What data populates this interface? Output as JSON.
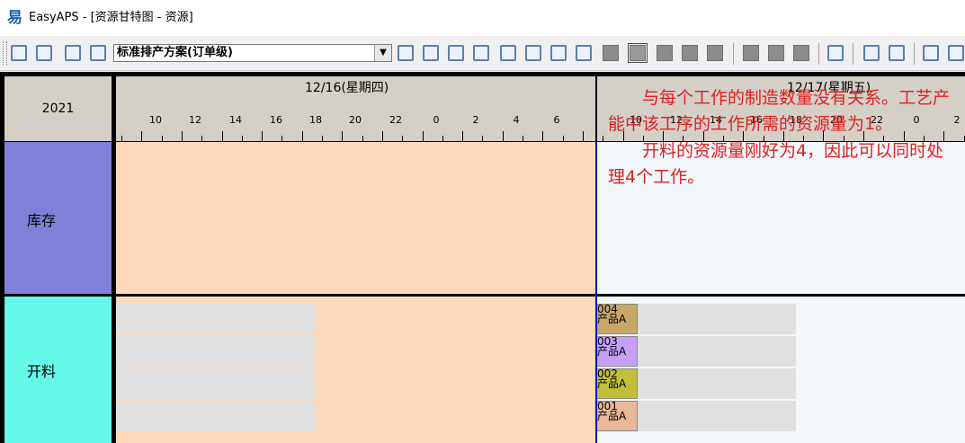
{
  "window": {
    "app_icon": "易",
    "title": "EasyAPS - [资源甘特图 - 资源]"
  },
  "toolbar": {
    "scheme_value": "标准排产方案(订单级)",
    "scheme_arrow": "▼"
  },
  "gantt": {
    "year": "2021",
    "days": [
      "12/16(星期四)",
      "12/17(星期五)"
    ],
    "hour_labels": [
      "10",
      "12",
      "14",
      "16",
      "18",
      "20",
      "22",
      "0",
      "2",
      "4",
      "6",
      "10",
      "12",
      "14",
      "16",
      "18",
      "20",
      "22",
      "0",
      "2"
    ],
    "resources": [
      {
        "name": "库存",
        "color": "#8080d8"
      },
      {
        "name": "开料",
        "color": "#66f8e8"
      }
    ],
    "tasks": [
      {
        "code": "004",
        "product": "产品A",
        "color": "#c8a868"
      },
      {
        "code": "003",
        "product": "产品A",
        "color": "#c4a0f8"
      },
      {
        "code": "002",
        "product": "产品A",
        "color": "#c0c038"
      },
      {
        "code": "001",
        "product": "产品A",
        "color": "#e8b898"
      }
    ]
  },
  "annotation": {
    "line1": "与每个工作的制造数量没有关系。工艺产能中该工序的工作所需的资源量为1。",
    "line2": "开料的资源量刚好为4，因此可以同时处理4个工作。"
  },
  "colors": {
    "schedule_bar": "#fdd9bb",
    "now_line": "#0000e0",
    "annotation_text": "#e02020"
  }
}
